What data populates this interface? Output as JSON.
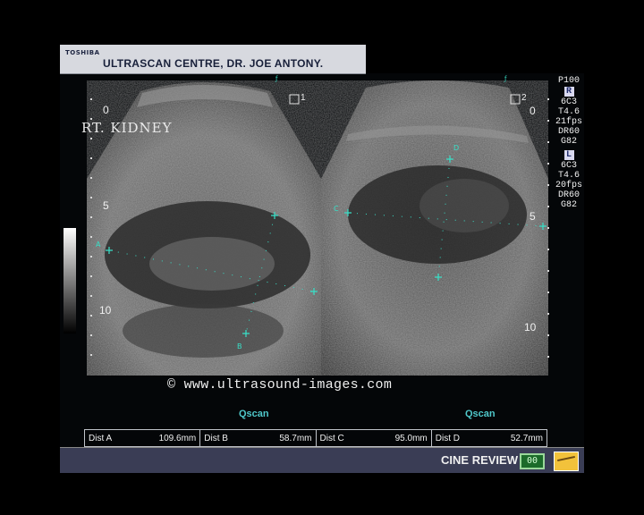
{
  "header": {
    "brand": "TOSHIBA",
    "facility": "ULTRASCAN CENTRE, DR. JOE ANTONY."
  },
  "image_label": "RT. KIDNEY",
  "copyright": "© www.ultrasound-images.com",
  "parameters": {
    "probe": "P100",
    "section_r": {
      "marker": "R",
      "lines": [
        "6C3",
        "T4.6",
        "21fps",
        "DR60",
        "G82"
      ]
    },
    "section_l": {
      "marker": "L",
      "lines": [
        "6C3",
        "T4.6",
        "20fps",
        "DR60",
        "G82"
      ]
    }
  },
  "panes": {
    "left": {
      "label": "1",
      "depth_labels": [
        "0",
        "5",
        "10"
      ],
      "mode": "Qscan"
    },
    "right": {
      "label": "2",
      "depth_labels": [
        "0",
        "5",
        "10"
      ],
      "mode": "Qscan"
    }
  },
  "calipers": {
    "labels": [
      "A",
      "B",
      "C",
      "D"
    ]
  },
  "measurements": [
    {
      "name": "Dist A",
      "value": "109.6mm"
    },
    {
      "name": "Dist B",
      "value": "58.7mm"
    },
    {
      "name": "Dist C",
      "value": "95.0mm"
    },
    {
      "name": "Dist D",
      "value": "52.7mm"
    }
  ],
  "cine": {
    "label": "CINE REVIEW",
    "button_text": "00",
    "logo_name": "cine-signature-icon"
  },
  "colors": {
    "caliper": "#38e0c8",
    "qscan": "#4fc8ca",
    "header_bg": "#d7d9df",
    "cine_bg": "#3a3d55"
  }
}
